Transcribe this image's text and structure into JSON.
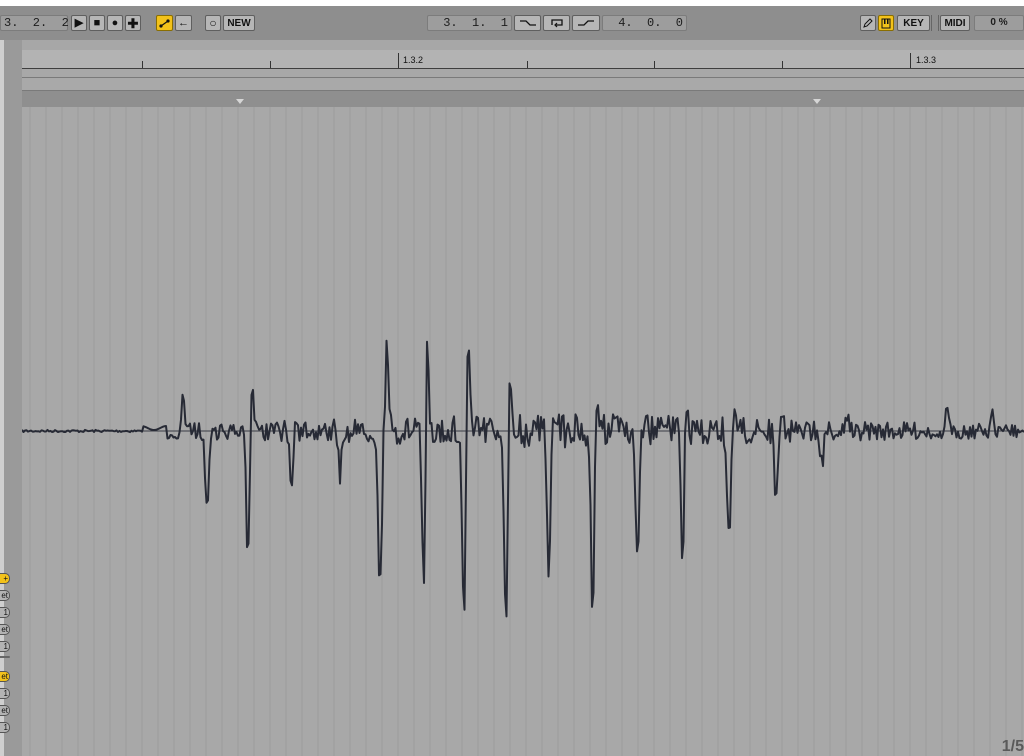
{
  "transport": {
    "arrangement_position": "3.  2.  2",
    "play_icon": "play-icon",
    "stop_icon": "stop-icon",
    "record_icon": "record-icon",
    "add_icon": "plus-icon",
    "automation_arm_icon": "automation-arm-icon",
    "back_to_arrangement_icon": "back-arrow-icon",
    "session_record_icon": "circle-icon",
    "new_label": "NEW"
  },
  "loop": {
    "start": "3.  1.  1",
    "punch_in_icon": "punch-in-icon",
    "loop_icon": "loop-icon",
    "punch_out_icon": "punch-out-icon",
    "length": "4.  0.  0"
  },
  "right_controls": {
    "draw_mode_icon": "pencil-icon",
    "computer_midi_keyboard_icon": "piano-keys-icon",
    "key_label": "KEY",
    "midi_label": "MIDI",
    "cpu_label": "0 %"
  },
  "ruler": {
    "labels": [
      "1.3.2",
      "1.3.3"
    ]
  },
  "side_buttons": [
    "+",
    "et",
    "1",
    "et",
    "1",
    "",
    "et",
    "1",
    "et",
    "1"
  ],
  "corner_text": "1/5",
  "colors": {
    "accent": "#f3c21a",
    "waveform": "#272a35",
    "editor_bg": "#a8a8a8"
  }
}
